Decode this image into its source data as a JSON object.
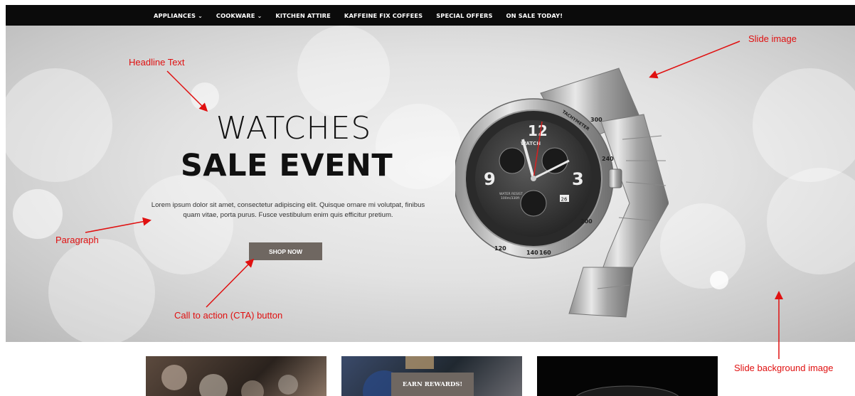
{
  "nav": {
    "items": [
      {
        "label": "APPLIANCES",
        "has_dropdown": true
      },
      {
        "label": "COOKWARE",
        "has_dropdown": true
      },
      {
        "label": "KITCHEN ATTIRE",
        "has_dropdown": false
      },
      {
        "label": "KAFFEINE FIX COFFEES",
        "has_dropdown": false
      },
      {
        "label": "SPECIAL OFFERS",
        "has_dropdown": false
      },
      {
        "label": "ON SALE TODAY!",
        "has_dropdown": false
      }
    ],
    "dropdown_glyph": "⌄"
  },
  "hero": {
    "headline_line1": "WATCHES",
    "headline_line2": "SALE EVENT",
    "paragraph": "Lorem ipsum dolor sit amet, consectetur adipiscing elit. Quisque ornare mi volutpat, finibus quam vitae, porta purus. Fusce vestibulum enim quis efficitur pretium.",
    "cta_label": "SHOP NOW",
    "watch": {
      "brand": "WATCH",
      "subtext_line1": "WATER RESIST",
      "subtext_line2": "100m/330ft",
      "date": "26",
      "dial_numbers": [
        "12",
        "3",
        "9"
      ],
      "tachymeter_label": "TACHYMETER",
      "bezel_numbers": [
        "120",
        "140",
        "160",
        "200",
        "240",
        "300"
      ]
    }
  },
  "annotations": {
    "headline": "Headline Text",
    "paragraph": "Paragraph",
    "cta": "Call to action (CTA) button",
    "slide_image": "Slide image",
    "slide_background": "Slide background image"
  },
  "cards": {
    "badge_label": "EARN REWARDS!"
  },
  "colors": {
    "nav_background": "#0b0b0b",
    "cta_background": "#6f6761",
    "annotation_red": "#e01010"
  }
}
